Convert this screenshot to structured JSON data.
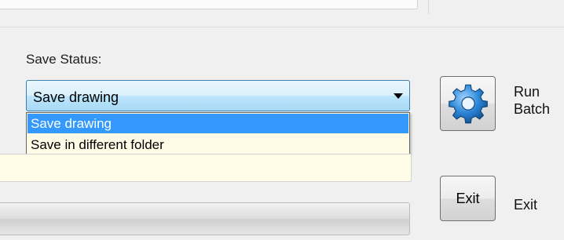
{
  "save_status": {
    "label": "Save Status:",
    "selected": "Save drawing",
    "options": [
      "Save drawing",
      "Save in different folder"
    ],
    "highlighted_index": 0
  },
  "run_batch": {
    "icon": "gear-icon",
    "label_line1": "Run",
    "label_line2": "Batch"
  },
  "exit": {
    "button_text": "Exit",
    "label": "Exit"
  },
  "log": {
    "value": ""
  },
  "progress": {
    "value": 0
  },
  "colors": {
    "selection": "#3399ff",
    "list_background": "#fffbe6",
    "combo_border": "#3c7fb1",
    "gear": "#2b86d6"
  }
}
